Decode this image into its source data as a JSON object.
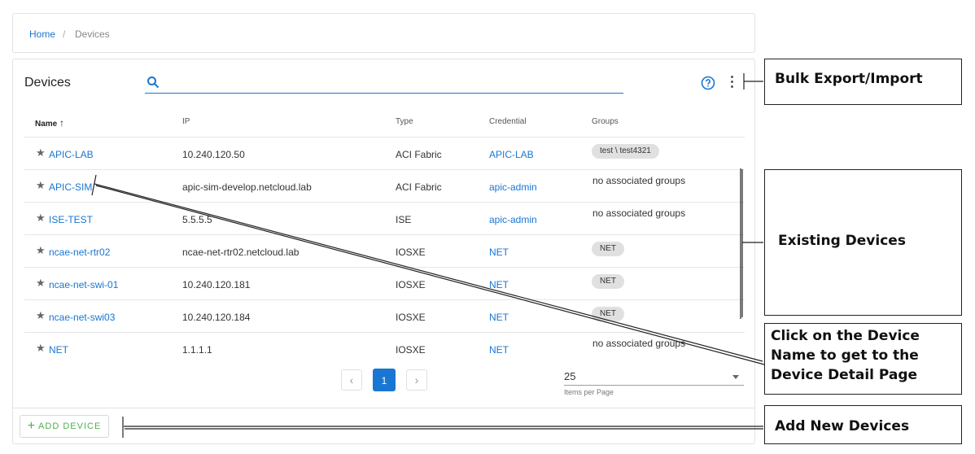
{
  "breadcrumb": {
    "home": "Home",
    "sep": "/",
    "current": "Devices"
  },
  "header": {
    "title": "Devices",
    "search_placeholder": "",
    "search_value": ""
  },
  "columns": [
    "Name",
    "IP",
    "Type",
    "Credential",
    "Groups"
  ],
  "sort_indicator": "↑",
  "rows": [
    {
      "name": "APIC-LAB",
      "ip": "10.240.120.50",
      "type": "ACI Fabric",
      "credential": "APIC-LAB",
      "groups": [
        "test \\ test4321"
      ],
      "groups_text": ""
    },
    {
      "name": "APIC-SIM",
      "ip": "apic-sim-develop.netcloud.lab",
      "type": "ACI Fabric",
      "credential": "apic-admin",
      "groups": [],
      "groups_text": "no associated groups"
    },
    {
      "name": "ISE-TEST",
      "ip": "5.5.5.5",
      "type": "ISE",
      "credential": "apic-admin",
      "groups": [],
      "groups_text": "no associated groups"
    },
    {
      "name": "ncae-net-rtr02",
      "ip": "ncae-net-rtr02.netcloud.lab",
      "type": "IOSXE",
      "credential": "NET",
      "groups": [
        "NET"
      ],
      "groups_text": ""
    },
    {
      "name": "ncae-net-swi-01",
      "ip": "10.240.120.181",
      "type": "IOSXE",
      "credential": "NET",
      "groups": [
        "NET"
      ],
      "groups_text": ""
    },
    {
      "name": "ncae-net-swi03",
      "ip": "10.240.120.184",
      "type": "IOSXE",
      "credential": "NET",
      "groups": [
        "NET"
      ],
      "groups_text": ""
    },
    {
      "name": "NET",
      "ip": "1.1.1.1",
      "type": "IOSXE",
      "credential": "NET",
      "groups": [],
      "groups_text": "no associated groups"
    }
  ],
  "pagination": {
    "prev": "‹",
    "page": "1",
    "next": "›",
    "per_page": "25",
    "per_page_label": "Items per Page"
  },
  "footer": {
    "add_label": "ADD DEVICE",
    "add_icon": "+"
  },
  "icons": {
    "search": "search-icon",
    "help": "help-circle-icon",
    "menu": "more-vert-icon",
    "star": "star-icon",
    "add": "plus-icon"
  },
  "colors": {
    "accent": "#1976d2",
    "add": "#4caf50",
    "chip": "#e0e0e0"
  },
  "annotations": {
    "bulk": "Bulk Export/Import",
    "existing": "Existing Devices",
    "click_l1": "Click on the Device",
    "click_l2": "Name to get to the",
    "click_l3": "Device Detail Page",
    "add": "Add New Devices"
  }
}
